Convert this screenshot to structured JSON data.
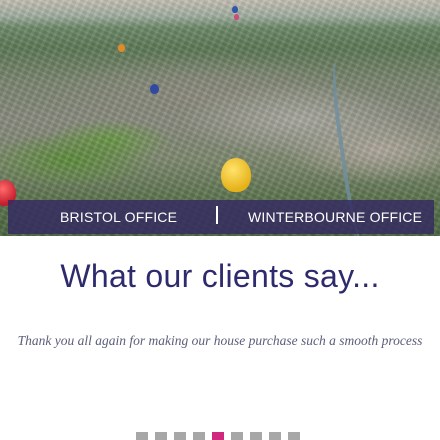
{
  "offices": {
    "bristol_label": "BRISTOL OFFICE",
    "winterbourne_label": "WINTERBOURNE OFFICE"
  },
  "testimonials": {
    "title": "What our clients say...",
    "quote": "Thank you all again for making our house purchase such a smooth process",
    "slide_count": 9,
    "active_slide": 4
  },
  "colors": {
    "title": "#2e2a6e",
    "office_bar": "#342a60",
    "dot_active": "#d0277f",
    "dot_inactive": "#a7a7a7"
  }
}
